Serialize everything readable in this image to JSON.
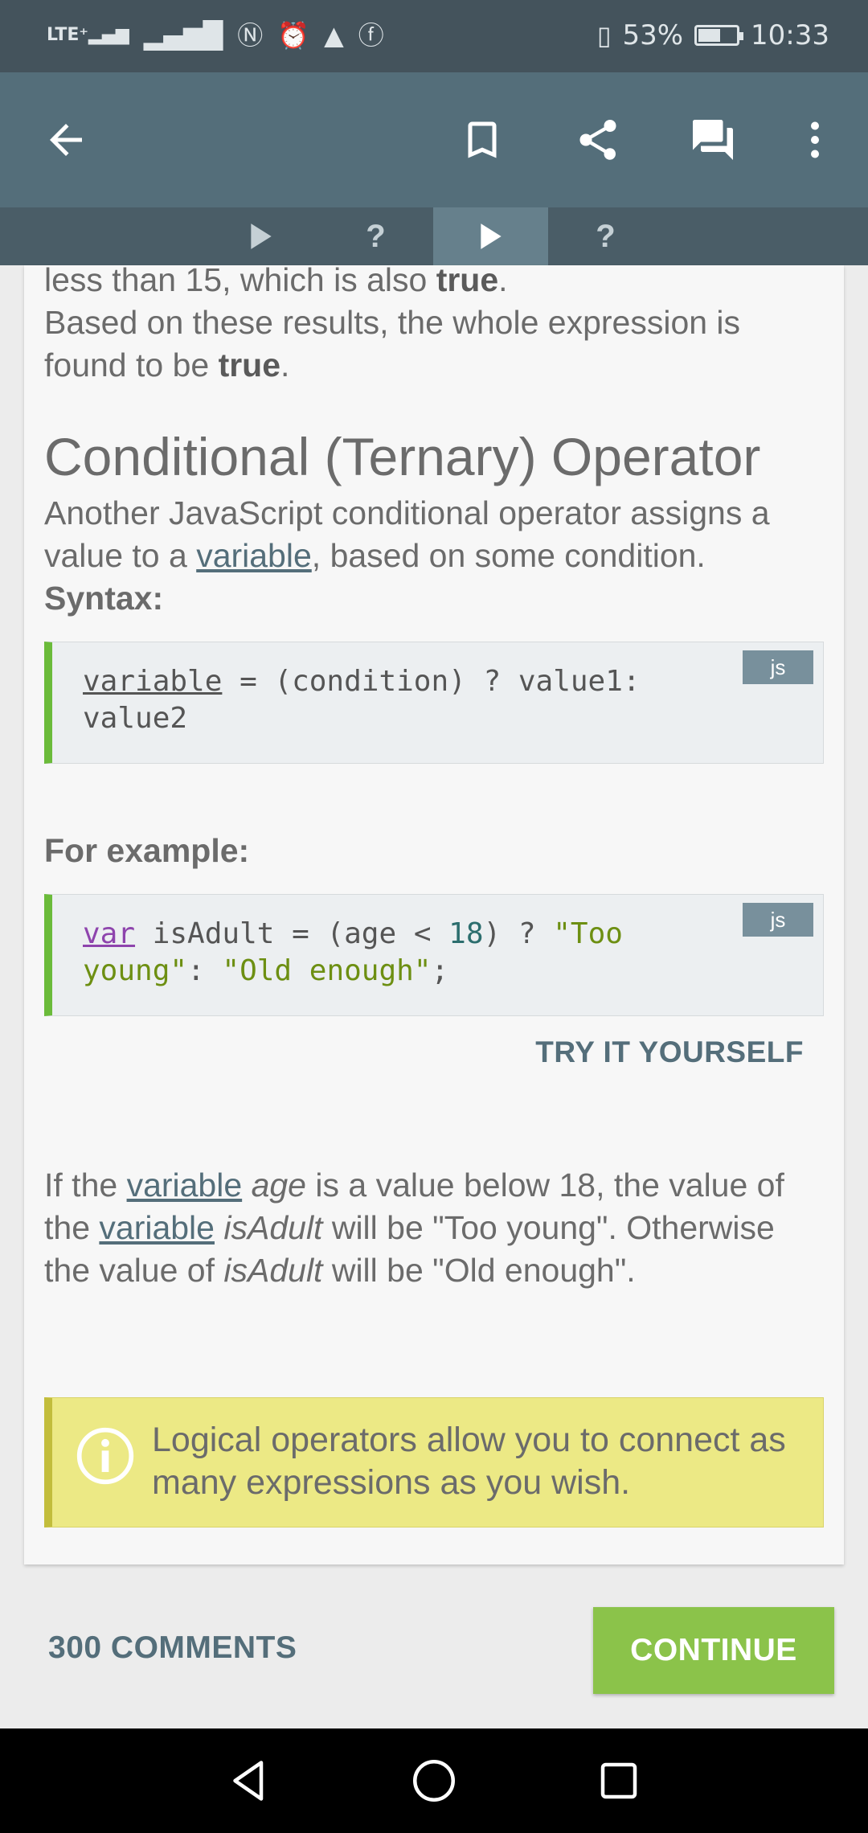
{
  "status_bar": {
    "network": "LTE⁺",
    "battery_percent": "53%",
    "time": "10:33"
  },
  "tabs": [
    {
      "kind": "play",
      "icon": "play-icon",
      "active": false
    },
    {
      "kind": "quiz",
      "label": "?",
      "active": false
    },
    {
      "kind": "play",
      "icon": "play-icon",
      "active": true
    },
    {
      "kind": "quiz",
      "label": "?",
      "active": false
    }
  ],
  "content": {
    "para1_line1_a": "less than 15, which is also ",
    "para1_line1_b": "true",
    "para1_line2_a": "Based on these results, the whole expression is found to be ",
    "para1_line2_b": "true",
    "heading": "Conditional (Ternary) Operator",
    "desc_a": "Another JavaScript conditional operator assigns a value to a ",
    "desc_link": "variable",
    "desc_b": ", based on some condition.",
    "syntax_label": "Syntax:",
    "code1": {
      "lang": "js",
      "var": "variable",
      "rest": " = (condition) ? value1:",
      "line2": "value2"
    },
    "example_label": "For example:",
    "code2": {
      "lang": "js",
      "kw": "var",
      "part1": " isAdult = (age < ",
      "num": "18",
      "part2": ") ? ",
      "str1": "\"Too",
      "str1b": "young\"",
      "part3": ": ",
      "str2": "\"Old enough\"",
      "end": ";"
    },
    "try_label": "TRY IT YOURSELF",
    "para2_a": "If the ",
    "para2_link1": "variable",
    "para2_age": "age",
    "para2_b": " is a value below 18, the value of the ",
    "para2_link2": "variable",
    "para2_isadult": "isAdult",
    "para2_c": " will be \"Too young\". Otherwise the value of ",
    "para2_isadult2": "isAdult",
    "para2_d": " will be \"Old enough\".",
    "note": "Logical operators allow you to connect as many expressions as you wish."
  },
  "footer": {
    "comments": "300 COMMENTS",
    "continue": "CONTINUE"
  },
  "colors": {
    "appbar": "#546e7a",
    "accent_green": "#8bc34a",
    "note_yellow": "#ece985"
  }
}
